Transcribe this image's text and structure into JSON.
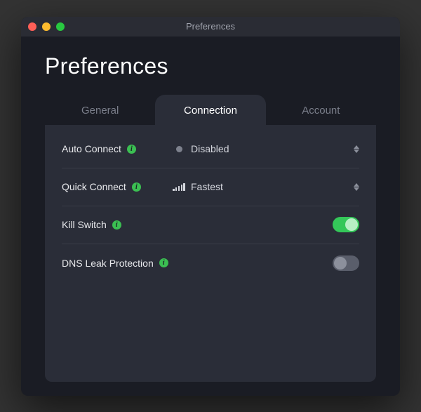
{
  "window": {
    "title": "Preferences"
  },
  "page": {
    "title": "Preferences"
  },
  "tabs": {
    "general": "General",
    "connection": "Connection",
    "account": "Account",
    "active": "connection"
  },
  "settings": {
    "auto_connect": {
      "label": "Auto Connect",
      "value": "Disabled"
    },
    "quick_connect": {
      "label": "Quick Connect",
      "value": "Fastest"
    },
    "kill_switch": {
      "label": "Kill Switch",
      "enabled": true
    },
    "dns_leak": {
      "label": "DNS Leak Protection",
      "enabled": false
    }
  }
}
